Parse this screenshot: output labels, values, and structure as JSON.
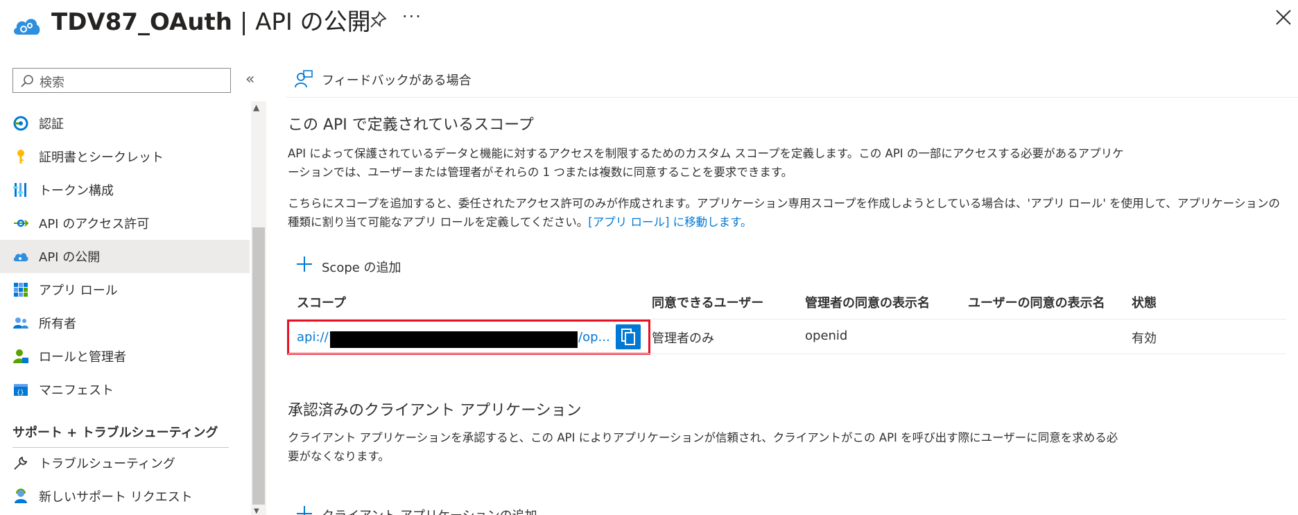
{
  "header": {
    "title_bold": "TDV87_OAuth",
    "title_rest": " | API の公開",
    "more_label": "···"
  },
  "sidebar": {
    "search_placeholder": "検索",
    "collapse_label": "«",
    "items": [
      {
        "label": "認証",
        "icon": "auth-icon"
      },
      {
        "label": "証明書とシークレット",
        "icon": "key-icon"
      },
      {
        "label": "トークン構成",
        "icon": "token-config-icon"
      },
      {
        "label": "API のアクセス許可",
        "icon": "api-permissions-icon"
      },
      {
        "label": "API の公開",
        "icon": "expose-api-icon",
        "active": true
      },
      {
        "label": "アプリ ロール",
        "icon": "app-roles-icon"
      },
      {
        "label": "所有者",
        "icon": "owners-icon"
      },
      {
        "label": "ロールと管理者",
        "icon": "roles-admins-icon"
      },
      {
        "label": "マニフェスト",
        "icon": "manifest-icon"
      }
    ],
    "support_section": {
      "title": "サポート + トラブルシューティング",
      "items": [
        {
          "label": "トラブルシューティング",
          "icon": "wrench-icon"
        },
        {
          "label": "新しいサポート リクエスト",
          "icon": "support-agent-icon"
        }
      ]
    }
  },
  "main": {
    "feedback_label": "フィードバックがある場合",
    "scopes": {
      "title": "この API で定義されているスコープ",
      "description_1": "API によって保護されているデータと機能に対するアクセスを制限するためのカスタム スコープを定義します。この API の一部にアクセスする必要があるアプリケーションでは、ユーザーまたは管理者がそれらの 1 つまたは複数に同意することを要求できます。",
      "description_2": "こちらにスコープを追加すると、委任されたアクセス許可のみが作成されます。アプリケーション専用スコープを作成しようとしている場合は、'アプリ ロール' を使用して、アプリケーションの種類に割り当て可能なアプリ ロールを定義してください。",
      "description_2_link": "[アプリ ロール] に移動します。",
      "add_label": "Scope の追加",
      "columns": [
        "スコープ",
        "同意できるユーザー",
        "管理者の同意の表示名",
        "ユーザーの同意の表示名",
        "状態"
      ],
      "rows": [
        {
          "scope_prefix": "api://",
          "scope_suffix": "/op...",
          "who_can_consent": "管理者のみ",
          "admin_display_name": "openid",
          "user_display_name": "",
          "state": "有効"
        }
      ]
    },
    "authorized_clients": {
      "title": "承認済みのクライアント アプリケーション",
      "description": "クライアント アプリケーションを承認すると、この API によりアプリケーションが信頼され、クライアントがこの API を呼び出す際にユーザーに同意を求める必要がなくなります。",
      "add_label": "クライアント アプリケーションの追加"
    }
  },
  "colors": {
    "accent": "#0078d4",
    "highlight_border": "#e81123",
    "active_nav_bg": "#edebe9"
  }
}
